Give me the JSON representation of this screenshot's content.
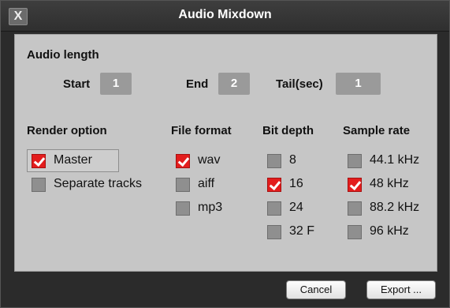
{
  "window": {
    "title": "Audio Mixdown",
    "close_glyph": "X"
  },
  "audio_length": {
    "heading": "Audio length",
    "start": {
      "label": "Start",
      "value": "1"
    },
    "end": {
      "label": "End",
      "value": "2"
    },
    "tail": {
      "label": "Tail(sec)",
      "value": "1"
    }
  },
  "render_option": {
    "heading": "Render option",
    "options": [
      {
        "label": "Master",
        "checked": true
      },
      {
        "label": "Separate tracks",
        "checked": false
      }
    ]
  },
  "file_format": {
    "heading": "File format",
    "options": [
      {
        "label": "wav",
        "checked": true
      },
      {
        "label": "aiff",
        "checked": false
      },
      {
        "label": "mp3",
        "checked": false
      }
    ]
  },
  "bit_depth": {
    "heading": "Bit depth",
    "options": [
      {
        "label": "8",
        "checked": false
      },
      {
        "label": "16",
        "checked": true
      },
      {
        "label": "24",
        "checked": false
      },
      {
        "label": "32 F",
        "checked": false
      }
    ]
  },
  "sample_rate": {
    "heading": "Sample rate",
    "options": [
      {
        "label": "44.1 kHz",
        "checked": false
      },
      {
        "label": "48 kHz",
        "checked": true
      },
      {
        "label": "88.2 kHz",
        "checked": false
      },
      {
        "label": "96 kHz",
        "checked": false
      }
    ]
  },
  "buttons": {
    "cancel": "Cancel",
    "export": "Export ..."
  },
  "colors": {
    "checked": "#e31d1d",
    "unchecked": "#8f8f8f",
    "field": "#9a9a9a",
    "panel": "#c6c6c6"
  }
}
